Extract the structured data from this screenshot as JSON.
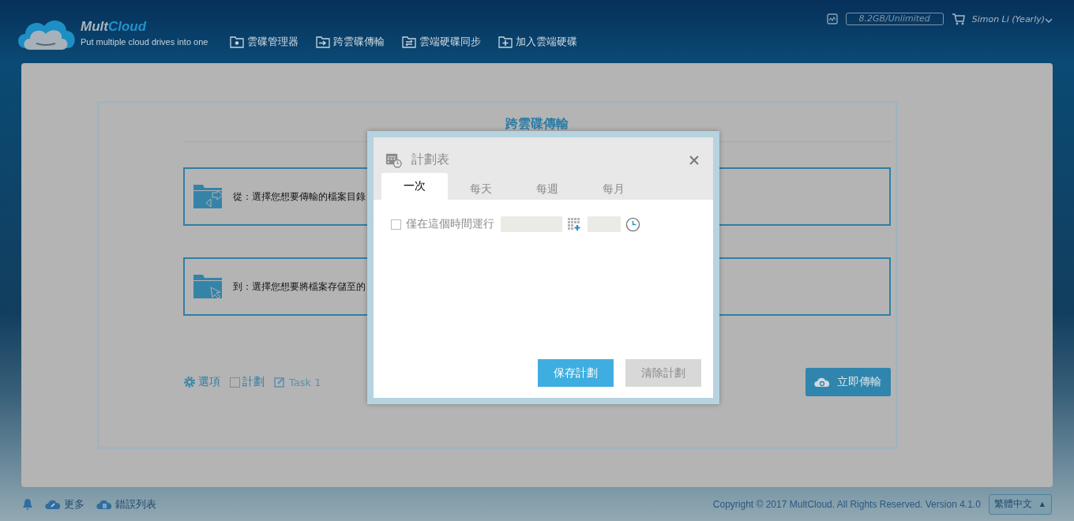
{
  "header": {
    "logo": {
      "first": "Mult",
      "second": "Cloud"
    },
    "tagline": "Put multiple cloud drives into one",
    "nav": [
      {
        "kind": "manager",
        "label": "雲碟管理器"
      },
      {
        "kind": "transfer",
        "label": "跨雲碟傳輸"
      },
      {
        "kind": "sync",
        "label": "雲端硬碟同步"
      },
      {
        "kind": "add",
        "label": "加入雲端硬碟"
      }
    ],
    "storage": "8.2GB/Unlimited",
    "user": "Simon Li (Yearly)"
  },
  "panel": {
    "title": "跨雲碟傳輸",
    "from": {
      "kind": "from",
      "label": "從：選擇您想要傳輸的檔案目錄"
    },
    "to": {
      "kind": "to",
      "label": "到：選擇您想要將檔案存儲至的"
    },
    "options": "選項",
    "schedule": {
      "label": "計劃",
      "checked": false
    },
    "task": "Task 1",
    "transfer_button": "立即傳輸"
  },
  "dialog": {
    "title": "計劃表",
    "tabs": [
      {
        "label": "一次",
        "selected": true
      },
      {
        "label": "每天",
        "selected": false
      },
      {
        "label": "每週",
        "selected": false
      },
      {
        "label": "每月",
        "selected": false
      }
    ],
    "run_once": {
      "label": "僅在這個時間運行",
      "checked": false
    },
    "buttons": [
      {
        "label": "保存計劃",
        "kind": "primary"
      },
      {
        "label": "清除計劃",
        "kind": "secondary"
      }
    ]
  },
  "footer": {
    "links": [
      {
        "kind": "bell"
      },
      {
        "kind": "more",
        "label": "更多"
      },
      {
        "kind": "errors",
        "label": "錯誤列表"
      }
    ],
    "copyright": "Copyright © 2017 MultCloud. All Rights Reserved. Version 4.1.0",
    "language": "繁體中文",
    "language_caret": "▲"
  }
}
